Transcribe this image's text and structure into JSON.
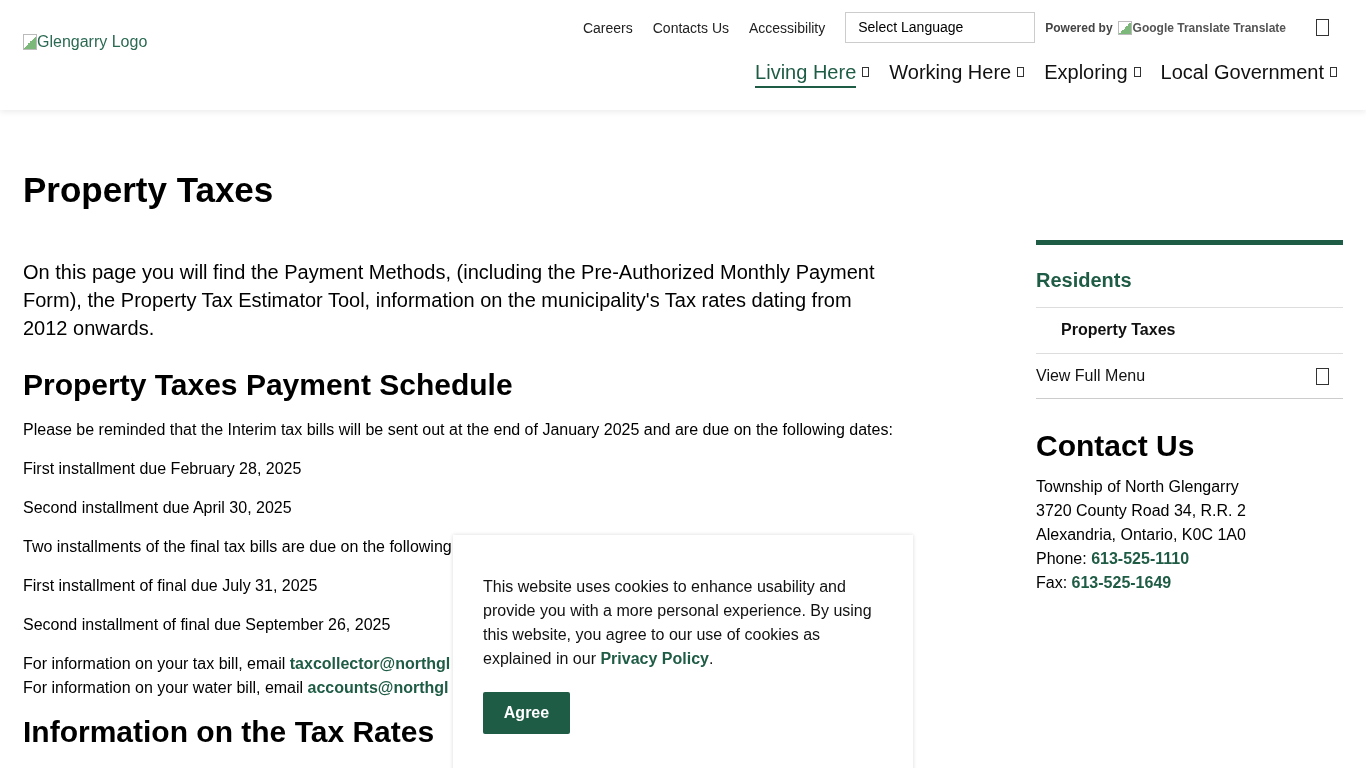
{
  "header": {
    "logo_alt": "Glengarry Logo",
    "utility_links": [
      "Careers",
      "Contacts Us",
      "Accessibility"
    ],
    "language_select": {
      "value": "Select Language"
    },
    "translate": {
      "powered_by": "Powered by",
      "image_alt": "Google Translate",
      "label": "Translate"
    },
    "nav": [
      {
        "label": "Living Here",
        "selected": true
      },
      {
        "label": "Working Here",
        "selected": false
      },
      {
        "label": "Exploring",
        "selected": false
      },
      {
        "label": "Local Government",
        "selected": false
      }
    ]
  },
  "main": {
    "title": "Property Taxes",
    "intro": "On this page you will find the Payment Methods, (including the Pre-Authorized Monthly Payment Form), the Property Tax Estimator Tool, information on the municipality's Tax rates dating from 2012 onwards.",
    "sections": [
      {
        "heading": "Property Taxes Payment Schedule",
        "paragraphs": [
          {
            "lines": [
              {
                "text": "Please be reminded that the Interim tax bills will be sent out at the end of January 2025 and are due on the following dates:"
              }
            ]
          },
          {
            "lines": [
              {
                "text": "First installment due February 28, 2025"
              }
            ]
          },
          {
            "lines": [
              {
                "text": "Second installment due April 30, 2025"
              }
            ]
          },
          {
            "lines": [
              {
                "text": "Two installments of the final tax bills are due on the following"
              }
            ]
          },
          {
            "lines": [
              {
                "text": "First installment of final due July 31, 2025"
              }
            ]
          },
          {
            "lines": [
              {
                "text": "Second installment of final due September 26, 2025"
              }
            ]
          },
          {
            "lines": [
              {
                "text": "For information on your tax bill, email ",
                "link": "taxcollector@northgl"
              },
              {
                "text": "For information on your water bill, email ",
                "link": "accounts@northgl"
              }
            ]
          }
        ]
      },
      {
        "heading": "Information on the Tax Rates"
      }
    ]
  },
  "sidebar": {
    "section_title": "Residents",
    "items": [
      {
        "label": "Property Taxes",
        "selected": true
      }
    ],
    "full_menu": "View Full Menu",
    "contact": {
      "heading": "Contact Us",
      "lines": [
        {
          "text": "Township of North Glengarry"
        },
        {
          "text": "3720 County Road 34, R.R. 2"
        },
        {
          "text": "Alexandria, Ontario, K0C 1A0"
        },
        {
          "text": "Phone: ",
          "link": "613-525-1110"
        },
        {
          "text": "Fax: ",
          "link": "613-525-1649"
        }
      ]
    }
  },
  "cookie_banner": {
    "text": "This website uses cookies to enhance usability and provide you with a more personal experience. By using this website, you agree to our use of cookies as explained in our ",
    "link": "Privacy Policy",
    "after": ".",
    "button": "Agree"
  }
}
